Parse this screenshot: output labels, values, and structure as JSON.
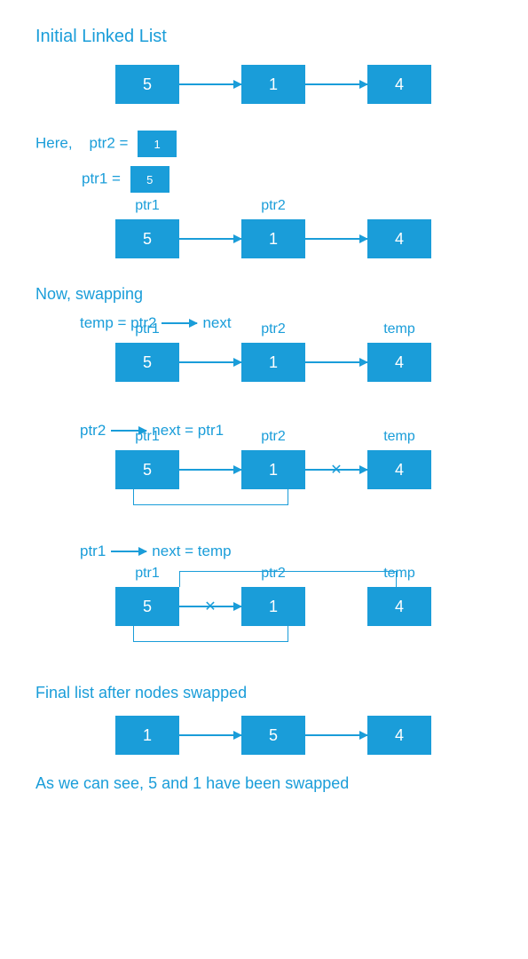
{
  "headings": {
    "initial": "Initial Linked List",
    "now_swapping": "Now,   swapping",
    "final": "Final list after nodes swapped",
    "conclusion": "As we can see,  5 and 1 have been swapped"
  },
  "labels": {
    "here": "Here,",
    "ptr2_eq": "ptr2  =",
    "ptr1_eq": "ptr1  =",
    "ptr1": "ptr1",
    "ptr2": "ptr2",
    "temp": "temp",
    "temp_eq_ptr2": "temp  =  ptr2",
    "next": "next",
    "ptr2_arrow": "ptr2",
    "next_eq_ptr1": "next  =  ptr1",
    "ptr1_arrow": "ptr1",
    "next_eq_temp": "next  =  temp"
  },
  "nodes": {
    "initial": [
      "5",
      "1",
      "4"
    ],
    "ptr2_small": "1",
    "ptr1_small": "5",
    "labeled": [
      "5",
      "1",
      "4"
    ],
    "final": [
      "1",
      "5",
      "4"
    ]
  },
  "colors": {
    "primary": "#1a9dd9"
  }
}
